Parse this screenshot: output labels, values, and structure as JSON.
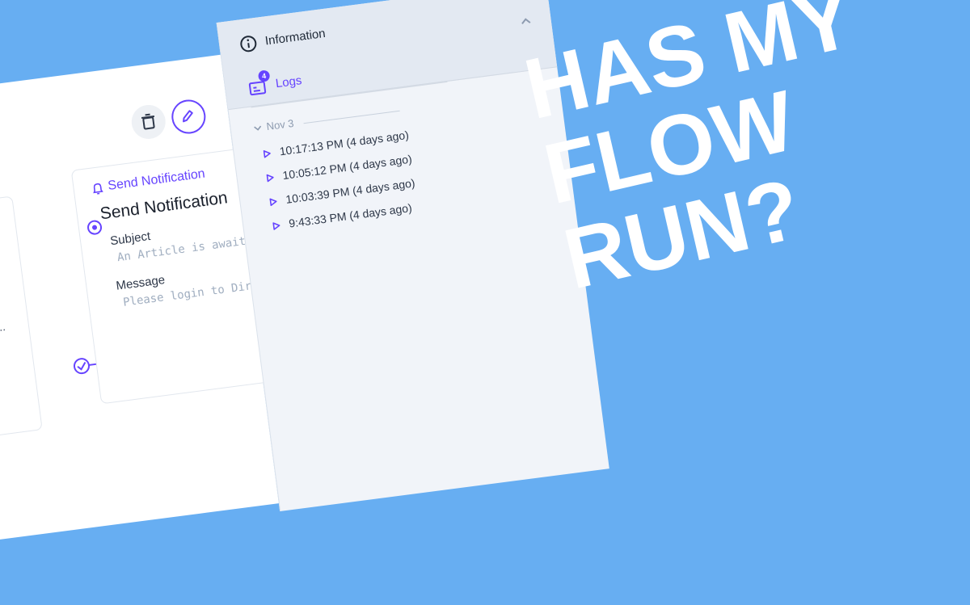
{
  "panel": {
    "information_label": "Information",
    "logs_label": "Logs",
    "logs_badge": "4",
    "date_group": "Nov 3",
    "log_entries": [
      "10:17:13 PM (4 days ago)",
      "10:05:12 PM (4 days ago)",
      "10:03:39 PM (4 days ago)",
      "9:43:33 PM (4 days ago)"
    ]
  },
  "card": {
    "tag": "Send Notification",
    "title": "Send Notification",
    "subject_label": "Subject",
    "subject_value": "An Article is awaiting a",
    "message_label": "Message",
    "message_value": "Please login to Directus"
  },
  "left_card": {
    "truncated_text": "..."
  },
  "headline": [
    "HAS MY",
    "FLOW",
    "RUN?"
  ],
  "colors": {
    "background": "#67aef2",
    "accent": "#6644ff"
  },
  "icons": [
    "close-icon",
    "info-icon",
    "chevron-up-icon",
    "logs-icon",
    "chevron-down-icon",
    "play-icon",
    "trash-icon",
    "pencil-icon",
    "bell-icon"
  ]
}
